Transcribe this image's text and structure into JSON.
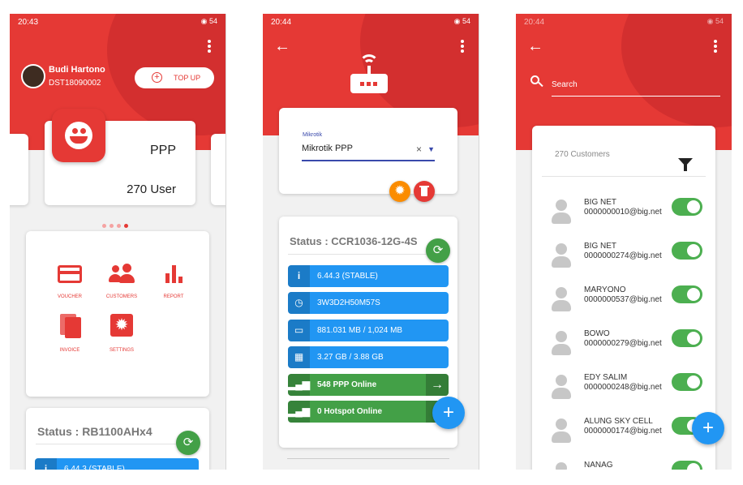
{
  "screen1": {
    "status_time": "20:43",
    "status_right": "◉ 54",
    "user_name": "Budi Hartono",
    "user_id": "DST18090002",
    "topup_label": "TOP UP",
    "service_title": "PPP",
    "service_count": "270 User",
    "menu": [
      {
        "label": "VOUCHER",
        "icon": "voucher-card-icon"
      },
      {
        "label": "CUSTOMERS",
        "icon": "customers-icon"
      },
      {
        "label": "REPORT",
        "icon": "report-chart-icon"
      },
      {
        "label": "INVOICE",
        "icon": "invoice-file-icon"
      },
      {
        "label": "SETTINGS",
        "icon": "settings-gear-icon"
      }
    ],
    "router_status": "Status : RB1100AHx4",
    "version_bar": "6.44.3 (STABLE)"
  },
  "screen2": {
    "status_time": "20:44",
    "status_right": "◉ 54",
    "select_label": "Mikrotik",
    "select_value": "Mikrotik PPP",
    "router_status": "Status : CCR1036-12G-4S",
    "bars": {
      "version": "6.44.3 (STABLE)",
      "uptime": "3W3D2H50M57S",
      "memory": "881.031 MB / 1,024 MB",
      "storage": "3.27 GB / 3.88 GB",
      "ppp_online": "548 PPP Online",
      "hotspot_online": "0 Hotspot Online"
    }
  },
  "screen3": {
    "status_time": "20:44",
    "status_right": "◉ 54",
    "search_placeholder": "Search",
    "customer_count": "270 Customers",
    "customers": [
      {
        "name": "BIG NET",
        "email": "0000000010@big.net"
      },
      {
        "name": "BIG NET",
        "email": "0000000274@big.net"
      },
      {
        "name": "MARYONO",
        "email": "0000000537@big.net"
      },
      {
        "name": "BOWO",
        "email": "0000000279@big.net"
      },
      {
        "name": "EDY SALIM",
        "email": "0000000248@big.net"
      },
      {
        "name": "ALUNG SKY CELL",
        "email": "0000000174@big.net"
      },
      {
        "name": "NANAG",
        "email": ""
      }
    ]
  },
  "colors": {
    "brand": "#e53935",
    "blue": "#2196f3",
    "green": "#43a047"
  }
}
